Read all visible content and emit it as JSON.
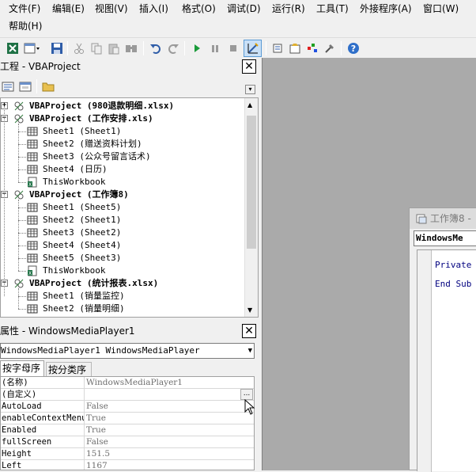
{
  "menu": {
    "items": [
      "文件(F)",
      "编辑(E)",
      "视图(V)",
      "插入(I)",
      "格式(O)",
      "调试(D)",
      "运行(R)",
      "工具(T)",
      "外接程序(A)",
      "窗口(W)",
      "帮助(H)"
    ]
  },
  "project_panel": {
    "title": "工程 - VBAProject",
    "close": "✕",
    "tree": [
      {
        "label": "VBAProject (980退款明细.xlsx)",
        "bold": true,
        "level": 0,
        "expander": "+"
      },
      {
        "label": "VBAProject (工作安排.xls)",
        "bold": true,
        "level": 0,
        "expander": "−"
      },
      {
        "label": "Sheet1 (Sheet1)",
        "bold": false,
        "level": 1
      },
      {
        "label": "Sheet2 (赠送资料计划)",
        "bold": false,
        "level": 1
      },
      {
        "label": "Sheet3 (公众号留言话术)",
        "bold": false,
        "level": 1
      },
      {
        "label": "Sheet4 (日历)",
        "bold": false,
        "level": 1
      },
      {
        "label": "ThisWorkbook",
        "bold": false,
        "level": 1,
        "wb": true
      },
      {
        "label": "VBAProject (工作簿8)",
        "bold": true,
        "level": 0,
        "expander": "−"
      },
      {
        "label": "Sheet1 (Sheet5)",
        "bold": false,
        "level": 1
      },
      {
        "label": "Sheet2 (Sheet1)",
        "bold": false,
        "level": 1
      },
      {
        "label": "Sheet3 (Sheet2)",
        "bold": false,
        "level": 1
      },
      {
        "label": "Sheet4 (Sheet4)",
        "bold": false,
        "level": 1
      },
      {
        "label": "Sheet5 (Sheet3)",
        "bold": false,
        "level": 1
      },
      {
        "label": "ThisWorkbook",
        "bold": false,
        "level": 1,
        "wb": true
      },
      {
        "label": "VBAProject (统计报表.xlsx)",
        "bold": true,
        "level": 0,
        "expander": "−"
      },
      {
        "label": "Sheet1 (销量监控)",
        "bold": false,
        "level": 1
      },
      {
        "label": "Sheet2 (销量明细)",
        "bold": false,
        "level": 1
      }
    ]
  },
  "properties_panel": {
    "title": "属性 - WindowsMediaPlayer1",
    "close": "✕",
    "object_combo": "WindowsMediaPlayer1 WindowsMediaPlayer",
    "tabs": [
      "按字母序",
      "按分类序"
    ],
    "rows": [
      {
        "name": "(名称)",
        "value": "WindowsMediaPlayer1"
      },
      {
        "name": "(自定义)",
        "value": "",
        "button": "..."
      },
      {
        "name": "AutoLoad",
        "value": "False"
      },
      {
        "name": "enableContextMenu",
        "value": "True"
      },
      {
        "name": "Enabled",
        "value": "True"
      },
      {
        "name": "fullScreen",
        "value": "False"
      },
      {
        "name": "Height",
        "value": "151.5"
      },
      {
        "name": "Left",
        "value": "1167"
      }
    ]
  },
  "code_window": {
    "title": "工作簿8 -",
    "object_combo": "WindowsMe",
    "lines": [
      "Private",
      "End Sub"
    ]
  },
  "colors": {
    "mdi_background": "#aaaaaa",
    "code_keyword": "#00007f",
    "panel_background": "#f0f0f0"
  }
}
